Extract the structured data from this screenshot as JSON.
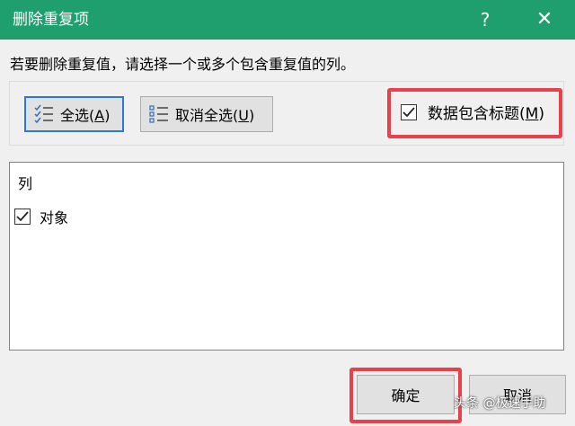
{
  "dialog": {
    "title": "删除重复项",
    "help": "?",
    "close": "✕"
  },
  "instruction": "若要删除重复值，请选择一个或多个包含重复值的列。",
  "toolbar": {
    "select_all_text": "全选(",
    "select_all_key": "A",
    "select_all_close": ")",
    "deselect_all_text": "取消全选(",
    "deselect_all_key": "U",
    "deselect_all_close": ")"
  },
  "header_option": {
    "label_text": "数据包含标题(",
    "label_key": "M",
    "label_close": ")",
    "checked": true
  },
  "columns": {
    "header": "列",
    "items": [
      {
        "label": "对象",
        "checked": true
      }
    ]
  },
  "footer": {
    "ok_label": "确定",
    "cancel_label": "取消"
  },
  "watermark": "头条 @极速手助",
  "colors": {
    "titlebar": "#1f9e6e",
    "highlight": "#e8414b",
    "focus": "#2a79d6"
  },
  "icons": {
    "select_all": "checklist-icon",
    "deselect_all": "list-icon",
    "checkmark": "checkmark-icon"
  }
}
